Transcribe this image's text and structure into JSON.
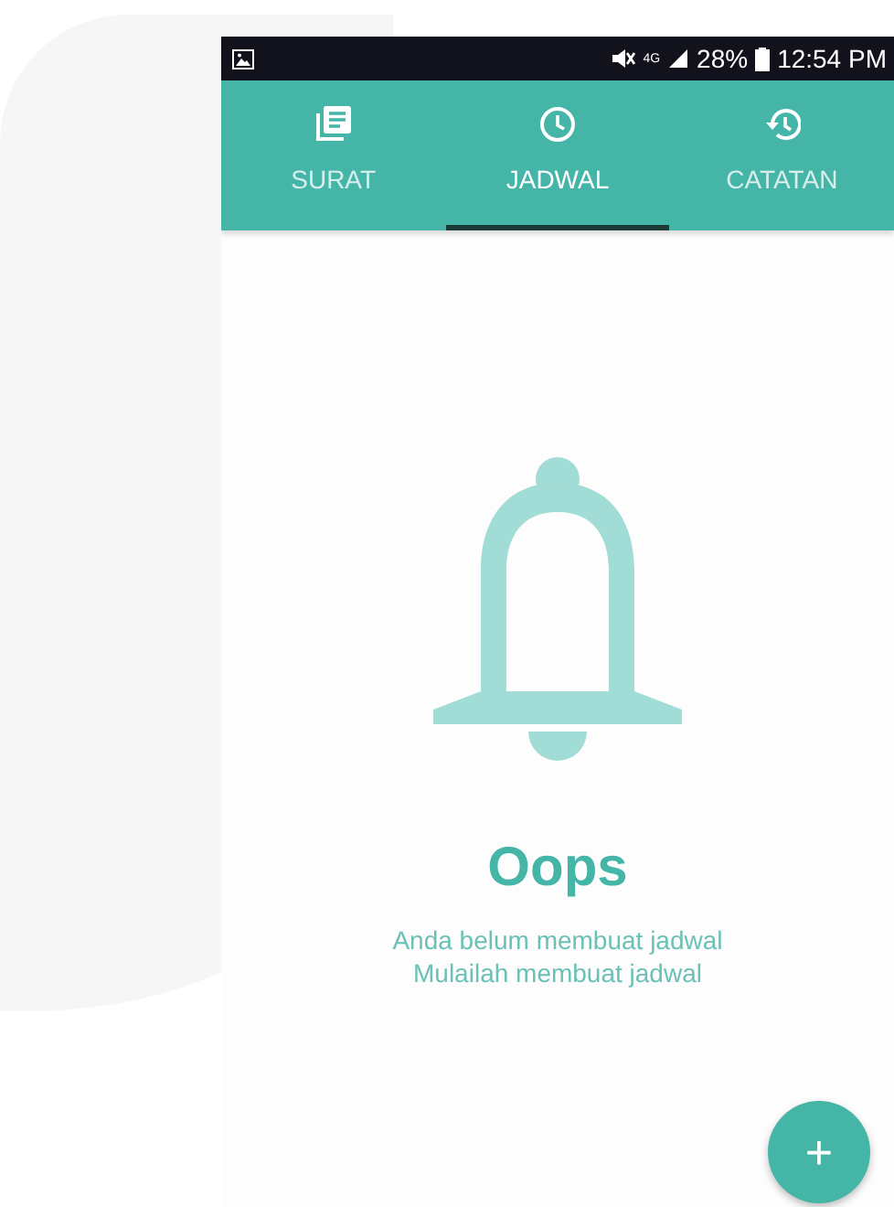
{
  "status_bar": {
    "network": "4G",
    "battery": "28%",
    "time": "12:54 PM"
  },
  "tabs": [
    {
      "label": "SURAT",
      "selected": false
    },
    {
      "label": "JADWAL",
      "selected": true
    },
    {
      "label": "CATATAN",
      "selected": false
    }
  ],
  "empty_state": {
    "title": "Oops",
    "lines": [
      "Anda belum membuat jadwal",
      "Mulailah membuat jadwal"
    ]
  },
  "fab": {
    "label": "+"
  }
}
